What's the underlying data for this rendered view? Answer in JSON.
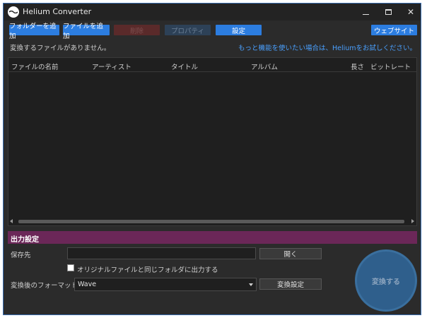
{
  "window": {
    "title": "Helium Converter"
  },
  "toolbar": {
    "add_folder": "フォルダーを追加",
    "add_file": "ファイルを追加",
    "delete": "削除",
    "properties": "プロパティ",
    "settings": "設定",
    "website": "ウェブサイト"
  },
  "status": {
    "no_files": "変換するファイルがありません。",
    "promo": "もっと機能を使いたい場合は、Heliumをお試しください。"
  },
  "list": {
    "columns": [
      "ファイルの名前",
      "アーティスト",
      "タイトル",
      "アルバム",
      "長さ",
      "ビットレート"
    ]
  },
  "output": {
    "section_title": "出力設定",
    "save_to_label": "保存先",
    "save_to_value": "",
    "open_button": "開く",
    "same_folder_checkbox": "オリジナルファイルと同じフォルダに出力する",
    "same_folder_checked": false,
    "format_label": "変換後のフォーマット:",
    "format_value": "Wave",
    "convert_settings_button": "変換設定",
    "convert_button": "変換する"
  },
  "colors": {
    "accent": "#2c7de0",
    "output_bar": "#6b2758",
    "window_bg": "#2b2b2b",
    "promo_link": "#4aa0ff"
  },
  "icons": [
    "helium-logo-icon",
    "minimize-icon",
    "maximize-icon",
    "close-icon",
    "scroll-left-icon",
    "scroll-right-icon",
    "dropdown-caret-icon"
  ]
}
